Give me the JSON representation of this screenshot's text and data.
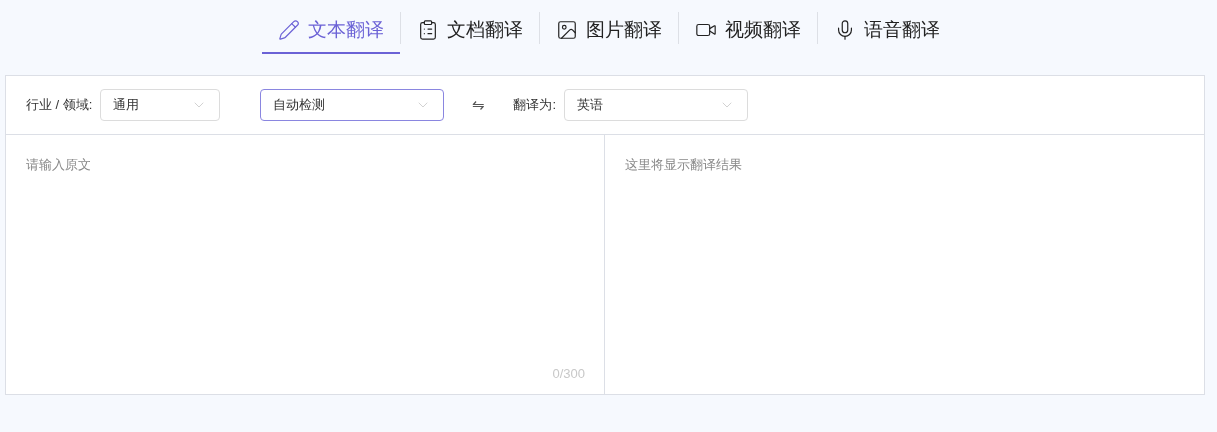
{
  "tabs": [
    {
      "label": "文本翻译",
      "kind": "text",
      "selected": true
    },
    {
      "label": "文档翻译",
      "kind": "document",
      "selected": false
    },
    {
      "label": "图片翻译",
      "kind": "image",
      "selected": false
    },
    {
      "label": "视频翻译",
      "kind": "video",
      "selected": false
    },
    {
      "label": "语音翻译",
      "kind": "voice",
      "selected": false
    }
  ],
  "toolbar": {
    "domain_label": "行业 / 领域:",
    "domain": {
      "value": "通用",
      "focused": false
    },
    "source": {
      "value": "自动检测",
      "focused": true
    },
    "swap": "⇋",
    "target_label": "翻译为:",
    "target": {
      "value": "英语",
      "focused": false
    }
  },
  "source_panel": {
    "placeholder": "请输入原文",
    "counter": "0/300"
  },
  "result_panel": {
    "placeholder": "这里将显示翻译结果"
  }
}
